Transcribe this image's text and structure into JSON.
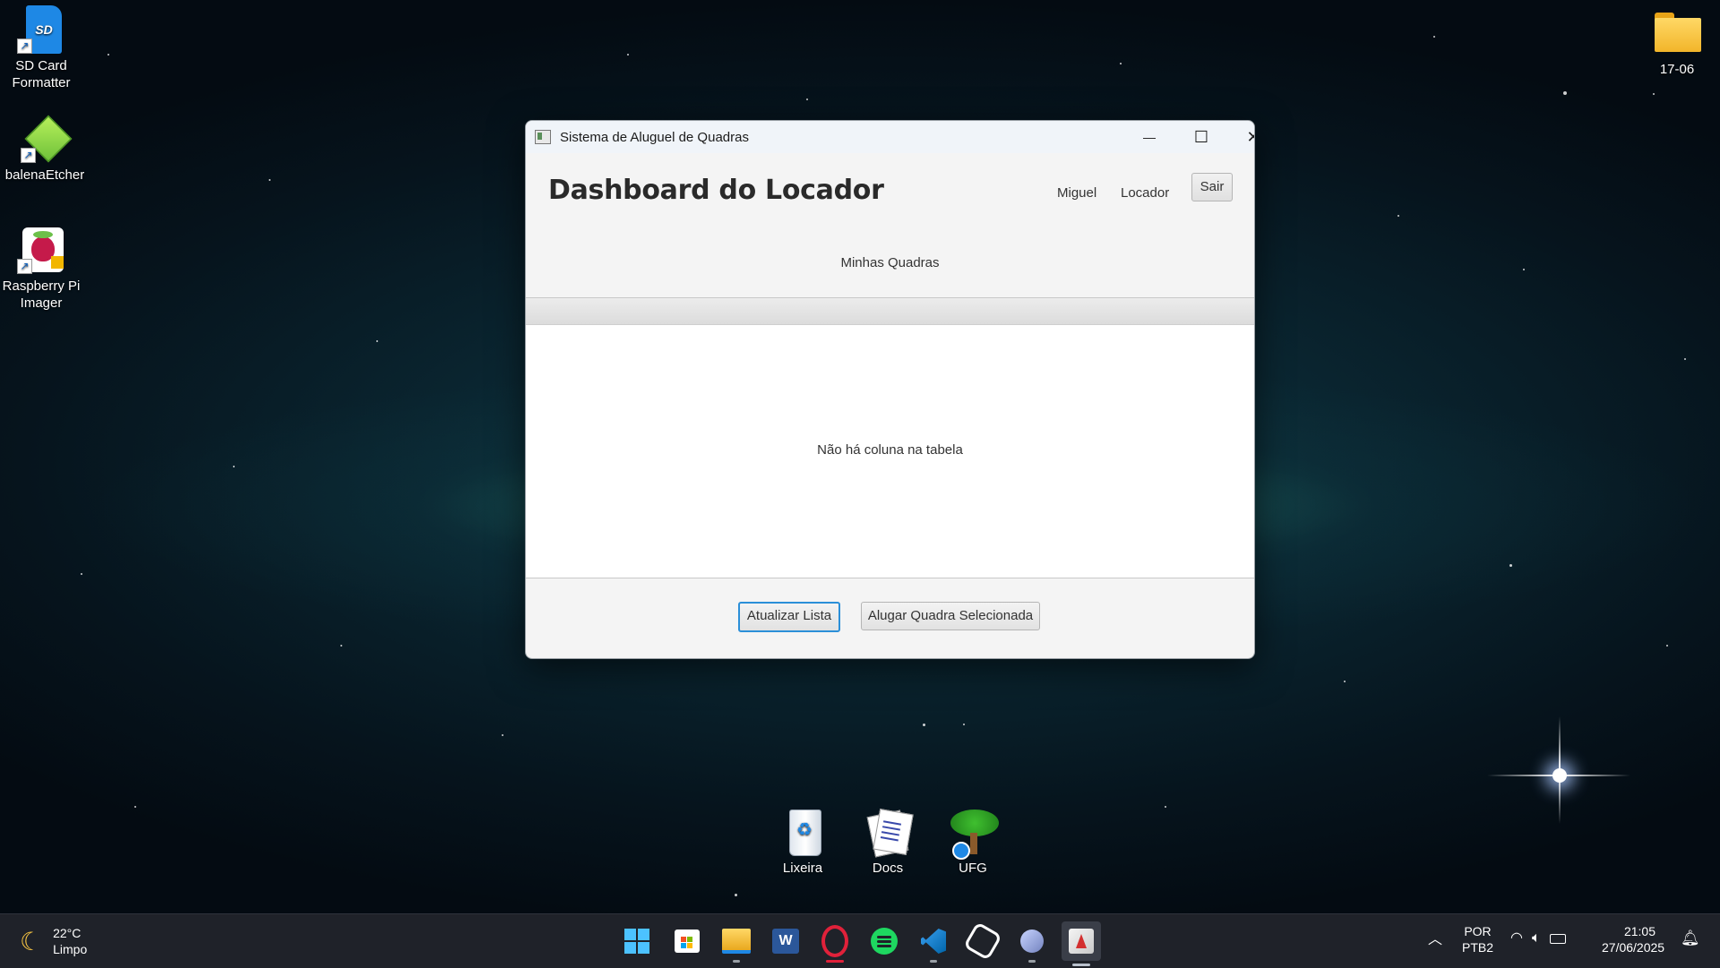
{
  "desktop": {
    "icons": [
      {
        "label_line1": "SD Card",
        "label_line2": "Formatter",
        "icon": "sd-card-icon"
      },
      {
        "label_line1": "balenaEtcher",
        "label_line2": "",
        "icon": "balena-etcher-icon"
      },
      {
        "label_line1": "Raspberry Pi",
        "label_line2": "Imager",
        "icon": "raspberry-pi-icon"
      },
      {
        "label_line1": "17-06",
        "label_line2": "",
        "icon": "folder-icon"
      },
      {
        "label_line1": "Lixeira",
        "label_line2": "",
        "icon": "recycle-bin-icon"
      },
      {
        "label_line1": "Docs",
        "label_line2": "",
        "icon": "documents-icon"
      },
      {
        "label_line1": "UFG",
        "label_line2": "",
        "icon": "tree-icon"
      }
    ]
  },
  "window": {
    "title": "Sistema de Aluguel de Quadras",
    "controls": {
      "minimize": "—",
      "maximize": "☐",
      "close": "✕"
    },
    "header": {
      "heading": "Dashboard do Locador",
      "user_name": "Miguel",
      "user_role": "Locador",
      "logout_label": "Sair"
    },
    "section_title": "Minhas Quadras",
    "table": {
      "columns": [],
      "rows": [],
      "empty_message": "Não há coluna na tabela"
    },
    "footer": {
      "refresh_label": "Atualizar Lista",
      "rent_label": "Alugar Quadra Selecionada"
    }
  },
  "taskbar": {
    "weather": {
      "temperature": "22°C",
      "condition": "Limpo"
    },
    "apps": [
      "start-icon",
      "store-icon",
      "file-explorer-icon",
      "word-icon",
      "opera-icon",
      "spotify-icon",
      "vscode-icon",
      "chatgpt-icon",
      "eclipse-icon",
      "java-app-icon"
    ],
    "language_line1": "POR",
    "language_line2": "PTB2",
    "time": "21:05",
    "date": "27/06/2025"
  },
  "colors": {
    "accent_focus": "#2b8fd8",
    "window_bg": "#f4f4f4",
    "taskbar_bg": "#1f2229"
  }
}
